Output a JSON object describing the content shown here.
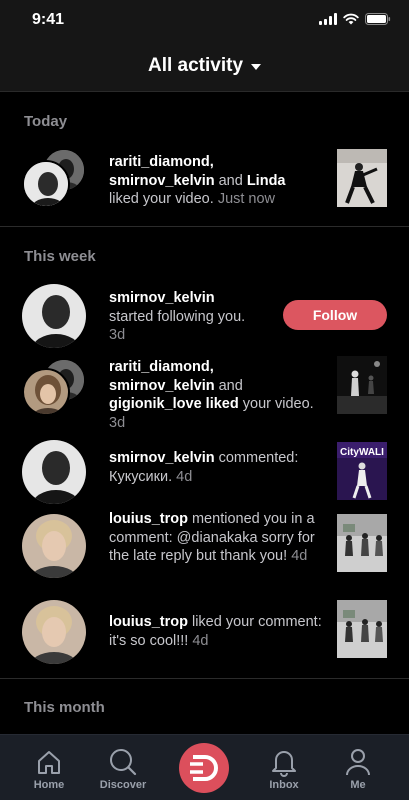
{
  "status_bar": {
    "time": "9:41"
  },
  "header": {
    "title": "All activity"
  },
  "sections": {
    "today": "Today",
    "this_week": "This week",
    "this_month": "This month"
  },
  "notifications": [
    {
      "user1": "rariti_diamond,",
      "user2": "smirnov_kelvin",
      "connector": " and ",
      "user3": "Linda",
      "action": "liked your video.",
      "time": "Just now"
    },
    {
      "user1": "smirnov_kelvin",
      "action": "started following you.",
      "time": "3d",
      "button": "Follow"
    },
    {
      "user1": "rariti_diamond,",
      "user2": "smirnov_kelvin",
      "connector": " and ",
      "user3": "gigionik_love liked",
      "action": " your video.",
      "time": "3d"
    },
    {
      "user1": "smirnov_kelvin",
      "action": " commented:",
      "comment": "Кукусики.",
      "time": "4d"
    },
    {
      "user1": "louius_trop",
      "action": " mentioned you in a comment: @dianakaka sorry for the late reply but thank you!",
      "time": "4d"
    },
    {
      "user1": "louius_trop",
      "action": " liked your comment:",
      "comment": "it's so cool!!!",
      "time": "4d"
    }
  ],
  "thumb_text": {
    "cityw": "CityWALI"
  },
  "tabbar": {
    "home": "Home",
    "discover": "Discover",
    "inbox": "Inbox",
    "me": "Me"
  },
  "colors": {
    "accent": "#dc5660",
    "background": "#000000",
    "tabbar": "#1b1f27"
  }
}
